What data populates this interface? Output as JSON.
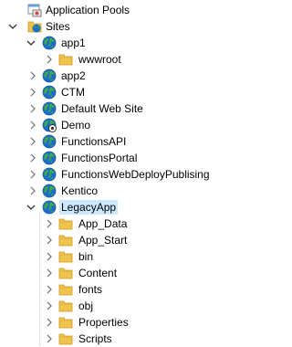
{
  "tree": {
    "application_pools": "Application Pools",
    "sites": "Sites",
    "app1": "app1",
    "wwwroot": "wwwroot",
    "app2": "app2",
    "ctm": "CTM",
    "default_web_site": "Default Web Site",
    "demo": "Demo",
    "functionsapi": "FunctionsAPI",
    "functionsportal": "FunctionsPortal",
    "functionswebdeploy": "FunctionsWebDeployPublising",
    "kentico": "Kentico",
    "legacyapp": "LegacyApp",
    "legacy_children": [
      "App_Data",
      "App_Start",
      "bin",
      "Content",
      "fonts",
      "obj",
      "Properties",
      "Scripts"
    ]
  },
  "colors": {
    "globe_blue": "#1e6fc8",
    "globe_green": "#3fae3a",
    "folder": "#f0c44c",
    "selection": "#cce8ff"
  },
  "icons": {
    "collapsed": "chevron-right-icon",
    "expanded": "chevron-down-icon",
    "site": "globe-icon",
    "folder": "folder-icon",
    "pools": "application-pools-icon",
    "sites": "sites-icon"
  }
}
